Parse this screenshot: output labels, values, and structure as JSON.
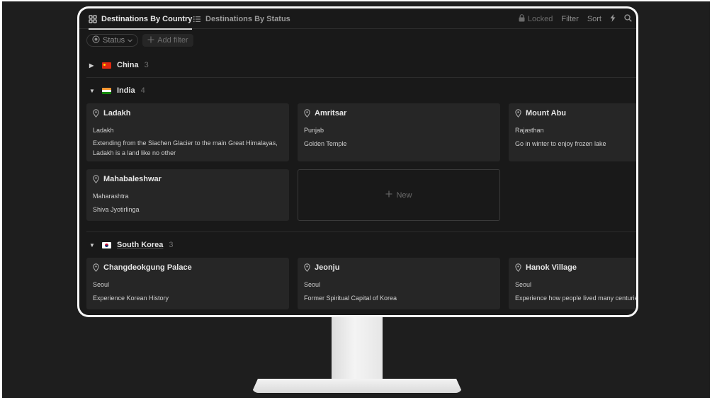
{
  "tabs": [
    {
      "label": "Destinations By Country",
      "icon": "gallery-icon",
      "active": true
    },
    {
      "label": "Destinations By Status",
      "icon": "list-icon",
      "active": false
    }
  ],
  "toolbar": {
    "locked": "Locked",
    "filter": "Filter",
    "sort": "Sort"
  },
  "filters": {
    "status": "Status",
    "add_filter": "Add filter"
  },
  "groups": [
    {
      "name": "China",
      "count": "3",
      "flag": "cn",
      "expanded": false
    },
    {
      "name": "India",
      "count": "4",
      "flag": "in",
      "expanded": true,
      "cards": [
        {
          "title": "Ladakh",
          "region": "Ladakh",
          "description": "Extending from the Siachen Glacier to the main Great Himalayas, Ladakh is a land like no other"
        },
        {
          "title": "Amritsar",
          "region": "Punjab",
          "description": "Golden Temple"
        },
        {
          "title": "Mount Abu",
          "region": "Rajasthan",
          "description": "Go in winter to enjoy frozen lake"
        },
        {
          "title": "Mahabaleshwar",
          "region": "Maharashtra",
          "description": "Shiva Jyotirlinga"
        }
      ],
      "new_label": "New"
    },
    {
      "name": "South Korea",
      "count": "3",
      "flag": "kr",
      "expanded": true,
      "cards": [
        {
          "title": "Changdeokgung Palace",
          "region": "Seoul",
          "description": "Experience Korean History"
        },
        {
          "title": "Jeonju",
          "region": "Seoul",
          "description": "Former Spiritual Capital of Korea"
        },
        {
          "title": "Hanok Village",
          "region": "Seoul",
          "description": "Experience how people lived many centuries ago"
        }
      ]
    }
  ],
  "colors": {
    "background": "#1e1e1e",
    "screen": "#191919",
    "card": "#262626",
    "text": "#e6e6e6",
    "muted": "#6f6f6f"
  }
}
